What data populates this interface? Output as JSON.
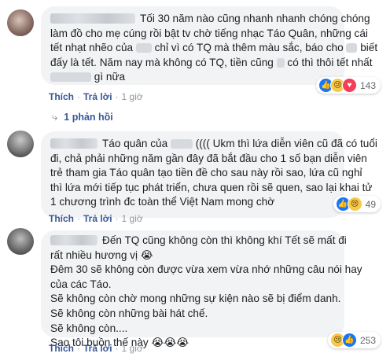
{
  "comments": [
    {
      "lines": [
        "Tối 30 năm nào cũng nhanh nhanh chóng chóng",
        "làm đồ cho mẹ cúng rồi bật tv chờ tiếng nhạc Táo Quân, những cái",
        "tết nhạt nhẽo của",
        "chỉ vì có TQ mà thêm màu sắc, báo cho",
        "biết",
        "đấy là tết. Năm nay mà không có TQ, tiền cũng",
        "có thì thôi tết nhất",
        "gì nữa"
      ],
      "actions": {
        "like": "Thích",
        "reply": "Trả lời",
        "time": "1 giờ"
      },
      "reactions": {
        "icons": [
          "like-icon",
          "sad-icon",
          "love-icon"
        ],
        "count": "143"
      },
      "replies_label": "1 phản hồi"
    },
    {
      "lines": [
        "Táo quân của",
        "(((( Ukm thì lứa diễn viên cũ đã có tuổi",
        "đi, chả phải những năm gần đây đã bắt đầu cho 1 số bạn diễn viên",
        "trẻ tham gia Táo quân tạo tiền đề cho sau này rồi sao, lứa cũ nghỉ",
        "thì lứa mới tiếp tục phát triển, chưa quen rồi sẽ quen, sao lại khai tử",
        "1 chương trình đc toàn thể Việt Nam mong chờ"
      ],
      "actions": {
        "like": "Thích",
        "reply": "Trả lời",
        "time": "1 giờ"
      },
      "reactions": {
        "icons": [
          "like-icon",
          "sad-icon"
        ],
        "count": "49"
      }
    },
    {
      "lines": [
        "Đến TQ cũng không còn thì không khí Tết sẽ mất đi",
        "rất nhiều hương vị",
        "Đêm 30 sẽ không còn được vừa xem vừa nhớ những câu nói hay",
        "của các Táo.",
        "Sẽ không còn chờ mong những sự kiện nào sẽ bị điểm danh.",
        "Sẽ không còn những bài hát chế.",
        "Sẽ không còn....",
        "Sao tôi buồn thế này"
      ],
      "emoji": "😭",
      "emoji_triple": "😭😭😭",
      "actions": {
        "like": "Thích",
        "reply": "Trả lời",
        "time": "1 giờ"
      },
      "reactions": {
        "icons": [
          "sad-icon",
          "like-icon"
        ],
        "count": "253"
      }
    }
  ]
}
